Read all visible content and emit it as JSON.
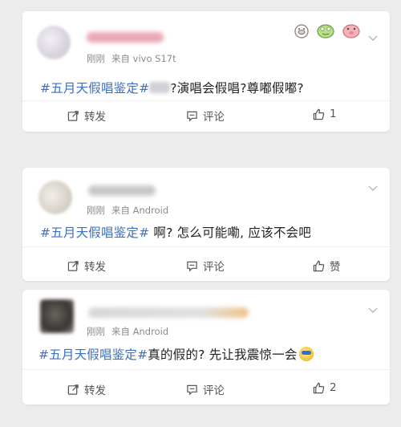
{
  "posts": [
    {
      "time": "刚刚",
      "source": "来自 vivo S17t",
      "tag": "#五月天假唱鉴定#",
      "text": "?演唱会假唱?尊嘟假嘟?",
      "repost_label": "转发",
      "comment_label": "评论",
      "like_label": "1"
    },
    {
      "time": "刚刚",
      "source": "来自 Android",
      "tag": "#五月天假唱鉴定#",
      "text": " 啊? 怎么可能嘞, 应该不会吧",
      "repost_label": "转发",
      "comment_label": "评论",
      "like_label": "赞"
    },
    {
      "time": "刚刚",
      "source": "来自 Android",
      "tag": "#五月天假唱鉴定#",
      "text": "真的假的? 先让我震惊一会",
      "repost_label": "转发",
      "comment_label": "评论",
      "like_label": "2"
    }
  ],
  "colors": {
    "tag": "#3a6fc4",
    "background": "#ececec",
    "card": "#ffffff",
    "meta": "#8a8a8a"
  },
  "icons": [
    "repost-icon",
    "comment-icon",
    "thumbs-up-icon",
    "chevron-down-icon",
    "sticker-icons"
  ]
}
